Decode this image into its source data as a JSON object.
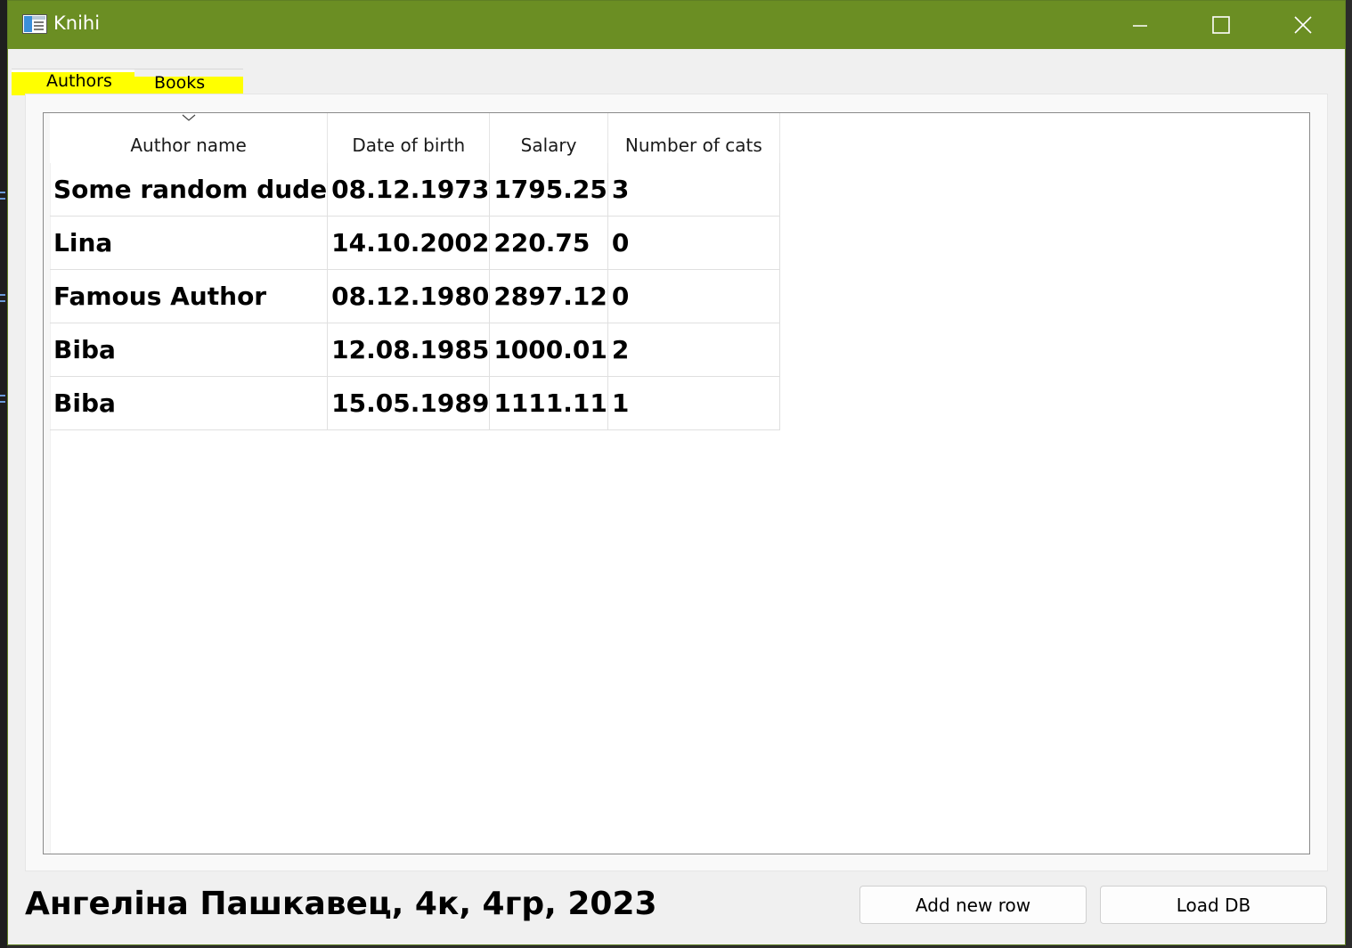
{
  "window": {
    "title": "Knihi",
    "icon": "app-icon",
    "title_bar_color": "#6b8e23",
    "controls": [
      "minimize-icon",
      "maximize-icon",
      "close-icon"
    ]
  },
  "tabs": [
    {
      "label": "Authors",
      "selected": true
    },
    {
      "label": "Books",
      "selected": false
    }
  ],
  "table": {
    "columns": [
      "Author name",
      "Date of birth",
      "Salary",
      "Number of cats"
    ],
    "sorted_column": "Author name",
    "sort_indicator": "chevron-down-icon",
    "rows": [
      [
        "Some random dude",
        "08.12.1973",
        "1795.25",
        "3"
      ],
      [
        "Lina",
        "14.10.2002",
        "220.75",
        "0"
      ],
      [
        "Famous Author",
        "08.12.1980",
        "2897.12",
        "0"
      ],
      [
        "Biba",
        "12.08.1985",
        "1000.01",
        "2"
      ],
      [
        "Biba",
        "15.05.1989",
        "1111.11",
        "1"
      ]
    ]
  },
  "footer": {
    "label": "Ангеліна Пашкавец, 4к, 4гр, 2023",
    "add_button": "Add new row",
    "load_button": "Load DB"
  }
}
